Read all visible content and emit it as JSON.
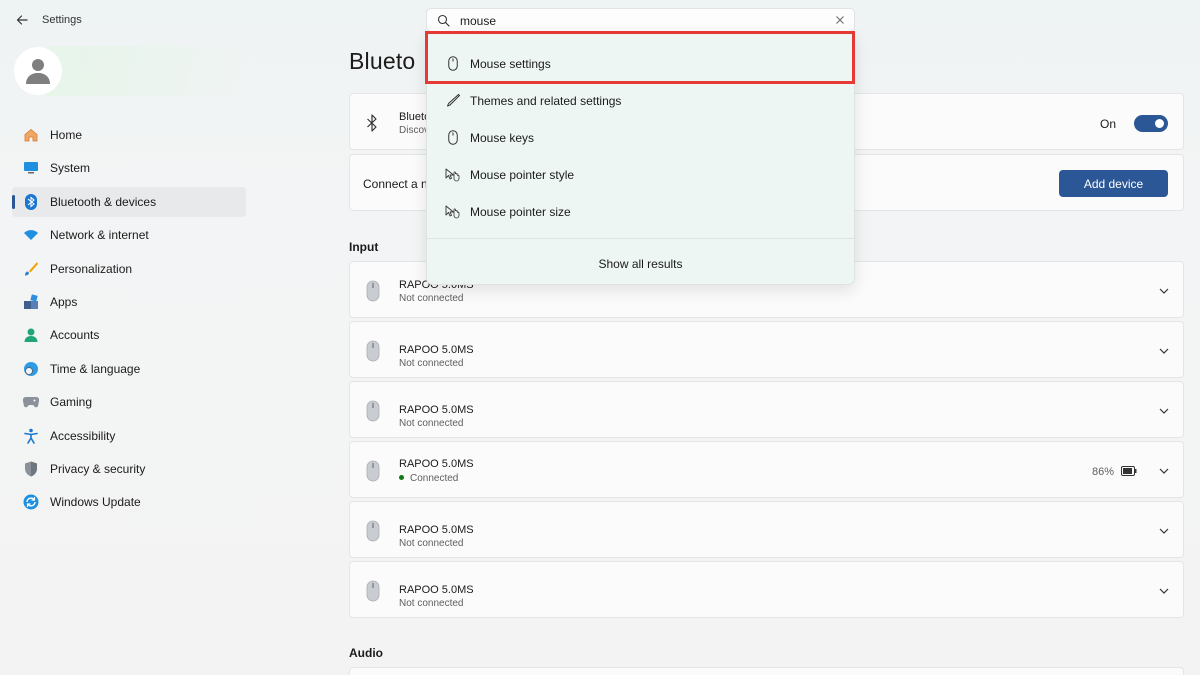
{
  "app": {
    "title": "Settings"
  },
  "sidebar": {
    "items": [
      {
        "label": "Home",
        "icon": "home-icon"
      },
      {
        "label": "System",
        "icon": "system-icon"
      },
      {
        "label": "Bluetooth & devices",
        "icon": "bluetooth-icon",
        "active": true
      },
      {
        "label": "Network & internet",
        "icon": "wifi-icon"
      },
      {
        "label": "Personalization",
        "icon": "brush-icon"
      },
      {
        "label": "Apps",
        "icon": "apps-icon"
      },
      {
        "label": "Accounts",
        "icon": "account-icon"
      },
      {
        "label": "Time & language",
        "icon": "globe-clock-icon"
      },
      {
        "label": "Gaming",
        "icon": "gamepad-icon"
      },
      {
        "label": "Accessibility",
        "icon": "accessibility-icon"
      },
      {
        "label": "Privacy & security",
        "icon": "shield-icon"
      },
      {
        "label": "Windows Update",
        "icon": "update-icon"
      }
    ]
  },
  "main": {
    "title": "Blueto",
    "bluetooth_card": {
      "name": "Blueto",
      "sub": "Discov",
      "toggle_label": "On",
      "toggle_on": true
    },
    "connect_card": {
      "label": "Connect a n",
      "button": "Add device"
    },
    "input_section": "Input",
    "devices": [
      {
        "name": "RAPOO 5.0MS",
        "status": "Not connected",
        "connected": false
      },
      {
        "name": "RAPOO 5.0MS",
        "status": "Not connected",
        "connected": false
      },
      {
        "name": "RAPOO 5.0MS",
        "status": "Not connected",
        "connected": false
      },
      {
        "name": "RAPOO 5.0MS",
        "status": "Connected",
        "connected": true,
        "battery": "86%"
      },
      {
        "name": "RAPOO 5.0MS",
        "status": "Not connected",
        "connected": false
      },
      {
        "name": "RAPOO 5.0MS",
        "status": "Not connected",
        "connected": false
      }
    ],
    "audio_section": "Audio"
  },
  "search": {
    "value": "mouse",
    "suggestions": [
      {
        "label": "Mouse settings",
        "icon": "mouse-icon",
        "highlighted": true
      },
      {
        "label": "Themes and related settings",
        "icon": "pen-icon"
      },
      {
        "label": "Mouse keys",
        "icon": "mouse-icon"
      },
      {
        "label": "Mouse pointer style",
        "icon": "pointer-icon"
      },
      {
        "label": "Mouse pointer size",
        "icon": "pointer-icon"
      }
    ],
    "show_all": "Show all results"
  },
  "colors": {
    "accent": "#2b5797",
    "highlight_box": "#e53935",
    "connected_dot": "#107c10"
  }
}
